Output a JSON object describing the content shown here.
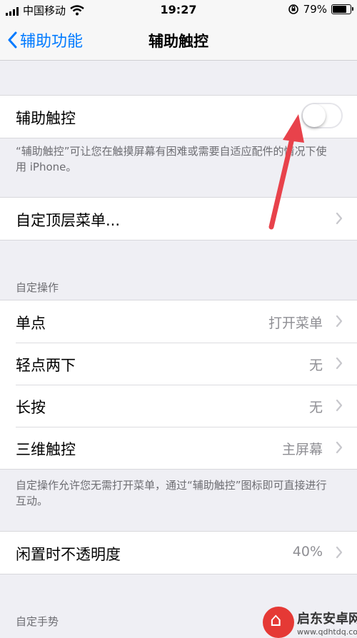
{
  "status_bar": {
    "carrier": "中国移动",
    "time": "19:27",
    "battery_text": "79%",
    "battery_level": 0.79
  },
  "nav": {
    "back_label": "辅助功能",
    "title": "辅助触控"
  },
  "assistive_touch": {
    "label": "辅助触控",
    "enabled": false,
    "note": "“辅助触控”可让您在触摸屏幕有困难或需要自适应配件的情况下使用 iPhone。"
  },
  "top_menu": {
    "label": "自定顶层菜单..."
  },
  "custom_actions": {
    "header": "自定操作",
    "rows": [
      {
        "label": "单点",
        "value": "打开菜单"
      },
      {
        "label": "轻点两下",
        "value": "无"
      },
      {
        "label": "长按",
        "value": "无"
      },
      {
        "label": "三维触控",
        "value": "主屏幕"
      }
    ],
    "note": "自定操作允许您无需打开菜单，通过“辅助触控”图标即可直接进行互动。"
  },
  "idle_opacity": {
    "label": "闲置时不透明度",
    "value": "40%"
  },
  "custom_gestures": {
    "header": "自定手势"
  },
  "watermark": {
    "title": "启东安卓网",
    "url": "www.qdhtdq.com"
  },
  "colors": {
    "accent": "#007aff",
    "arrow": "#e8424b",
    "background": "#efeff4"
  }
}
